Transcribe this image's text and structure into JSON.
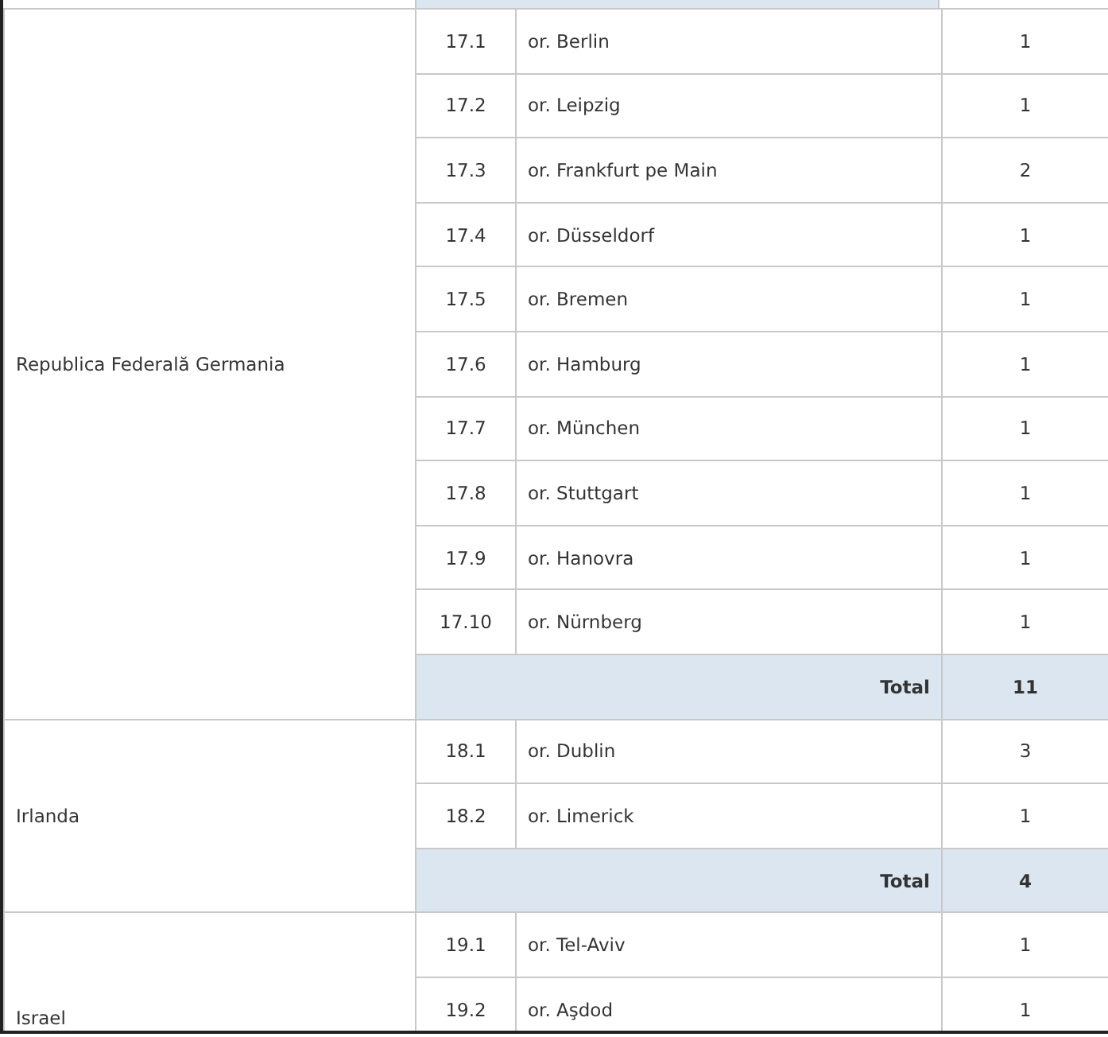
{
  "table": {
    "groups": [
      {
        "country": "Republica Federală Germania",
        "rows": [
          {
            "number": "17.1",
            "city": "or. Berlin",
            "count": "1"
          },
          {
            "number": "17.2",
            "city": "or. Leipzig",
            "count": "1"
          },
          {
            "number": "17.3",
            "city": "or. Frankfurt pe Main",
            "count": "2"
          },
          {
            "number": "17.4",
            "city": "or. Düsseldorf",
            "count": "1"
          },
          {
            "number": "17.5",
            "city": "or. Bremen",
            "count": "1"
          },
          {
            "number": "17.6",
            "city": "or. Hamburg",
            "count": "1"
          },
          {
            "number": "17.7",
            "city": "or. München",
            "count": "1"
          },
          {
            "number": "17.8",
            "city": "or. Stuttgart",
            "count": "1"
          },
          {
            "number": "17.9",
            "city": "or. Hanovra",
            "count": "1"
          },
          {
            "number": "17.10",
            "city": "or. Nürnberg",
            "count": "1"
          }
        ],
        "total": {
          "label": "Total",
          "value": "11"
        }
      },
      {
        "country": "Irlanda",
        "rows": [
          {
            "number": "18.1",
            "city": "or. Dublin",
            "count": "3"
          },
          {
            "number": "18.2",
            "city": "or. Limerick",
            "count": "1"
          }
        ],
        "total": {
          "label": "Total",
          "value": "4"
        }
      },
      {
        "country": "Israel",
        "rows": [
          {
            "number": "19.1",
            "city": "or. Tel-Aviv",
            "count": "1"
          },
          {
            "number": "19.2",
            "city": "or. Aşdod",
            "count": "1"
          }
        ]
      }
    ]
  }
}
